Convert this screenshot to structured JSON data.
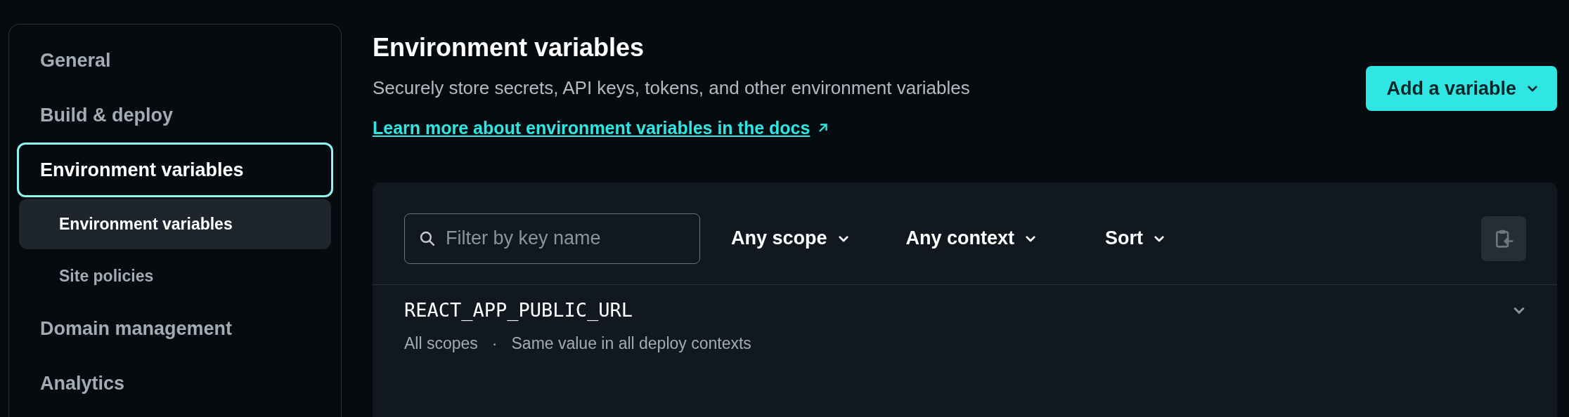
{
  "sidebar": {
    "items": [
      {
        "label": "General",
        "selected": false
      },
      {
        "label": "Build & deploy",
        "selected": false
      },
      {
        "label": "Environment variables",
        "selected": true,
        "children": [
          {
            "label": "Environment variables",
            "selected": true
          },
          {
            "label": "Site policies",
            "selected": false
          }
        ]
      },
      {
        "label": "Domain management",
        "selected": false
      },
      {
        "label": "Analytics",
        "selected": false
      }
    ]
  },
  "header": {
    "title": "Environment variables",
    "description": "Securely store secrets, API keys, tokens, and other environment variables",
    "link": "Learn more about environment variables in the docs",
    "button": "Add a variable"
  },
  "toolbar": {
    "search": {
      "placeholder": "Filter by key name"
    },
    "filters": [
      "Any scope",
      "Any context",
      "Sort"
    ]
  },
  "variables": [
    {
      "key": "REACT_APP_PUBLIC_URL",
      "scope": "All scopes",
      "separator": "·",
      "context": "Same value in all deploy contexts",
      "expanded": false
    }
  ]
}
